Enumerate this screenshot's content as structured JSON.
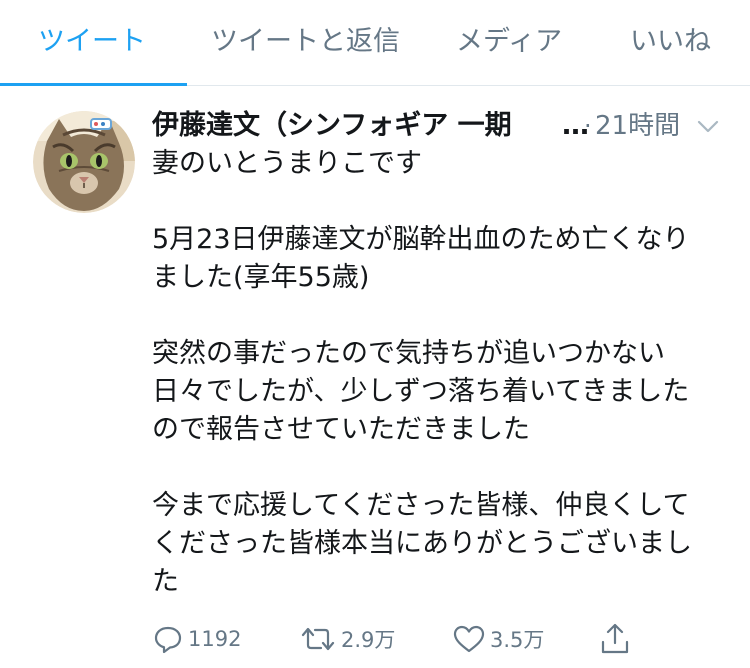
{
  "tabs": [
    {
      "label": "ツイート",
      "active": true
    },
    {
      "label": "ツイートと返信",
      "active": false
    },
    {
      "label": "メディア",
      "active": false
    },
    {
      "label": "いいね",
      "active": false
    }
  ],
  "tweet": {
    "author_name": "伊藤達文（シンフォギア 一期",
    "name_ellipsis": "…",
    "separator": "·",
    "timestamp": "21時間",
    "body_lines": [
      [
        "妻のいとうまりこです"
      ],
      [
        "5月23日伊藤達文が脳幹出血のため亡くなり",
        "ました(享年55歳)"
      ],
      [
        "突然の事だったので気持ちが追いつかない",
        "日々でしたが、少しずつ落ち着いてきました",
        "ので報告させていただきました"
      ],
      [
        "今まで応援してくださった皆様、仲良くして",
        "くださった皆様本当にありがとうございまし",
        "た"
      ]
    ],
    "replies": "1192",
    "retweets": "2.9万",
    "likes": "3.5万"
  },
  "colors": {
    "accent": "#1da1f2",
    "text": "#14171a",
    "muted": "#657786",
    "divider": "#e1e8ed"
  },
  "icons": [
    "reply-icon",
    "retweet-icon",
    "like-icon",
    "share-icon",
    "chevron-down-icon"
  ]
}
